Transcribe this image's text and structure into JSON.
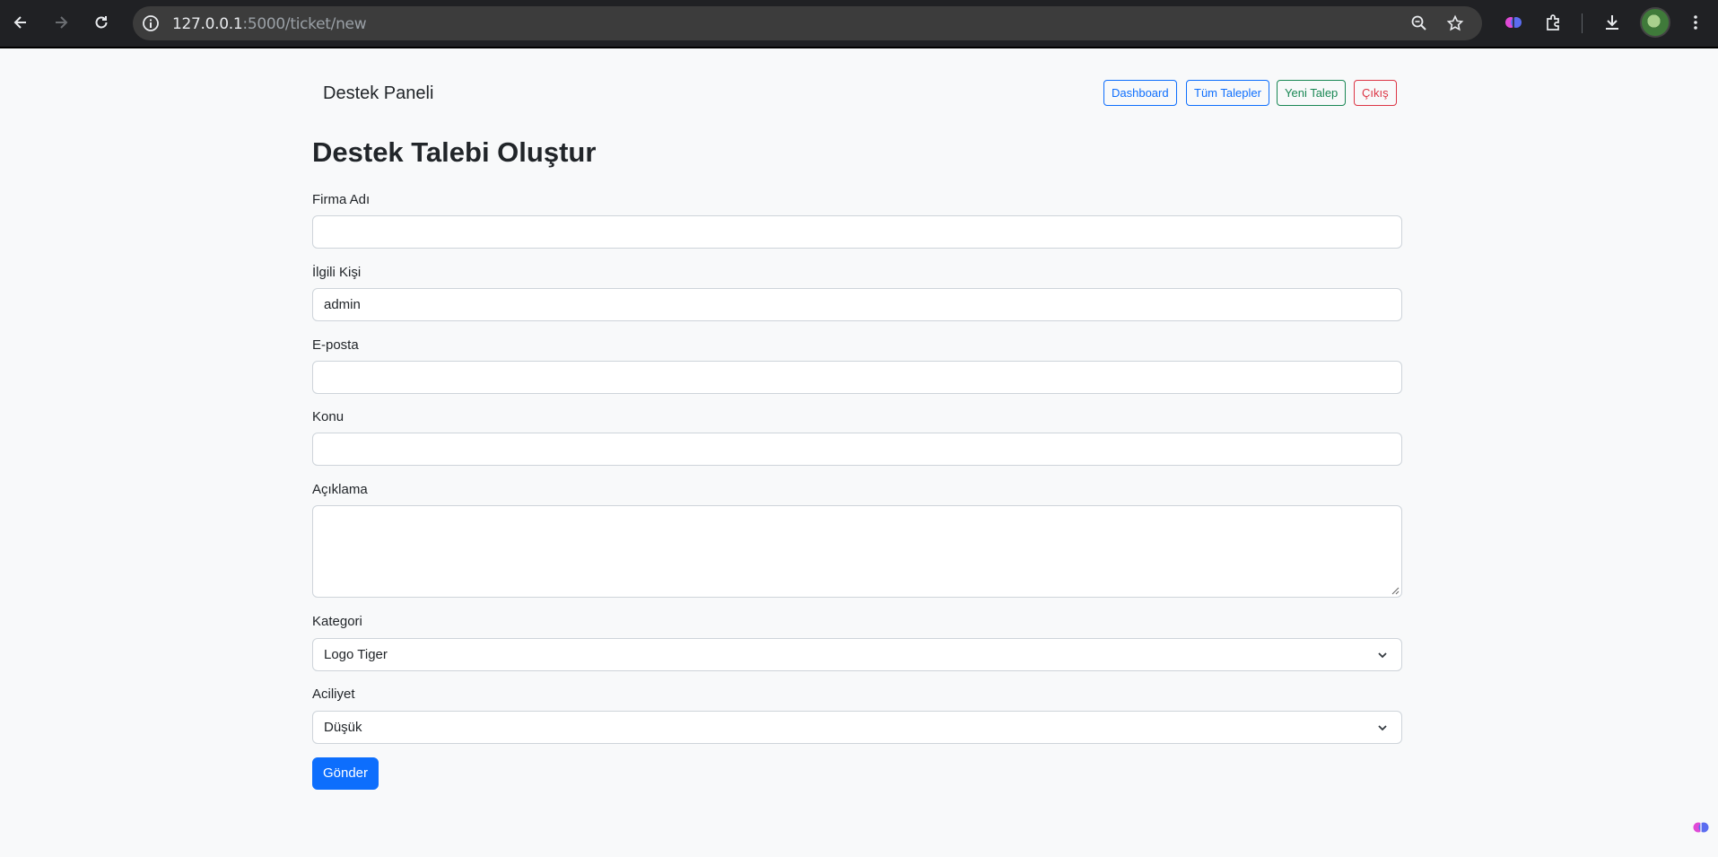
{
  "browser": {
    "url_host": "127.0.0.1",
    "url_path": ":5000/ticket/new"
  },
  "header": {
    "brand": "Destek Paneli",
    "nav": {
      "dashboard": "Dashboard",
      "all_tickets": "Tüm Talepler",
      "new_ticket": "Yeni Talep",
      "logout": "Çıkış"
    }
  },
  "form": {
    "title": "Destek Talebi Oluştur",
    "company": {
      "label": "Firma Adı",
      "value": ""
    },
    "contact": {
      "label": "İlgili Kişi",
      "value": "admin"
    },
    "email": {
      "label": "E-posta",
      "value": ""
    },
    "subject": {
      "label": "Konu",
      "value": ""
    },
    "description": {
      "label": "Açıklama",
      "value": ""
    },
    "category": {
      "label": "Kategori",
      "selected": "Logo Tiger"
    },
    "priority": {
      "label": "Aciliyet",
      "selected": "Düşük"
    },
    "submit": "Gönder"
  },
  "colors": {
    "primary": "#0d6efd",
    "success": "#198754",
    "danger": "#dc3545",
    "page_bg": "#f8f9fa",
    "chrome_bg": "#202124"
  }
}
